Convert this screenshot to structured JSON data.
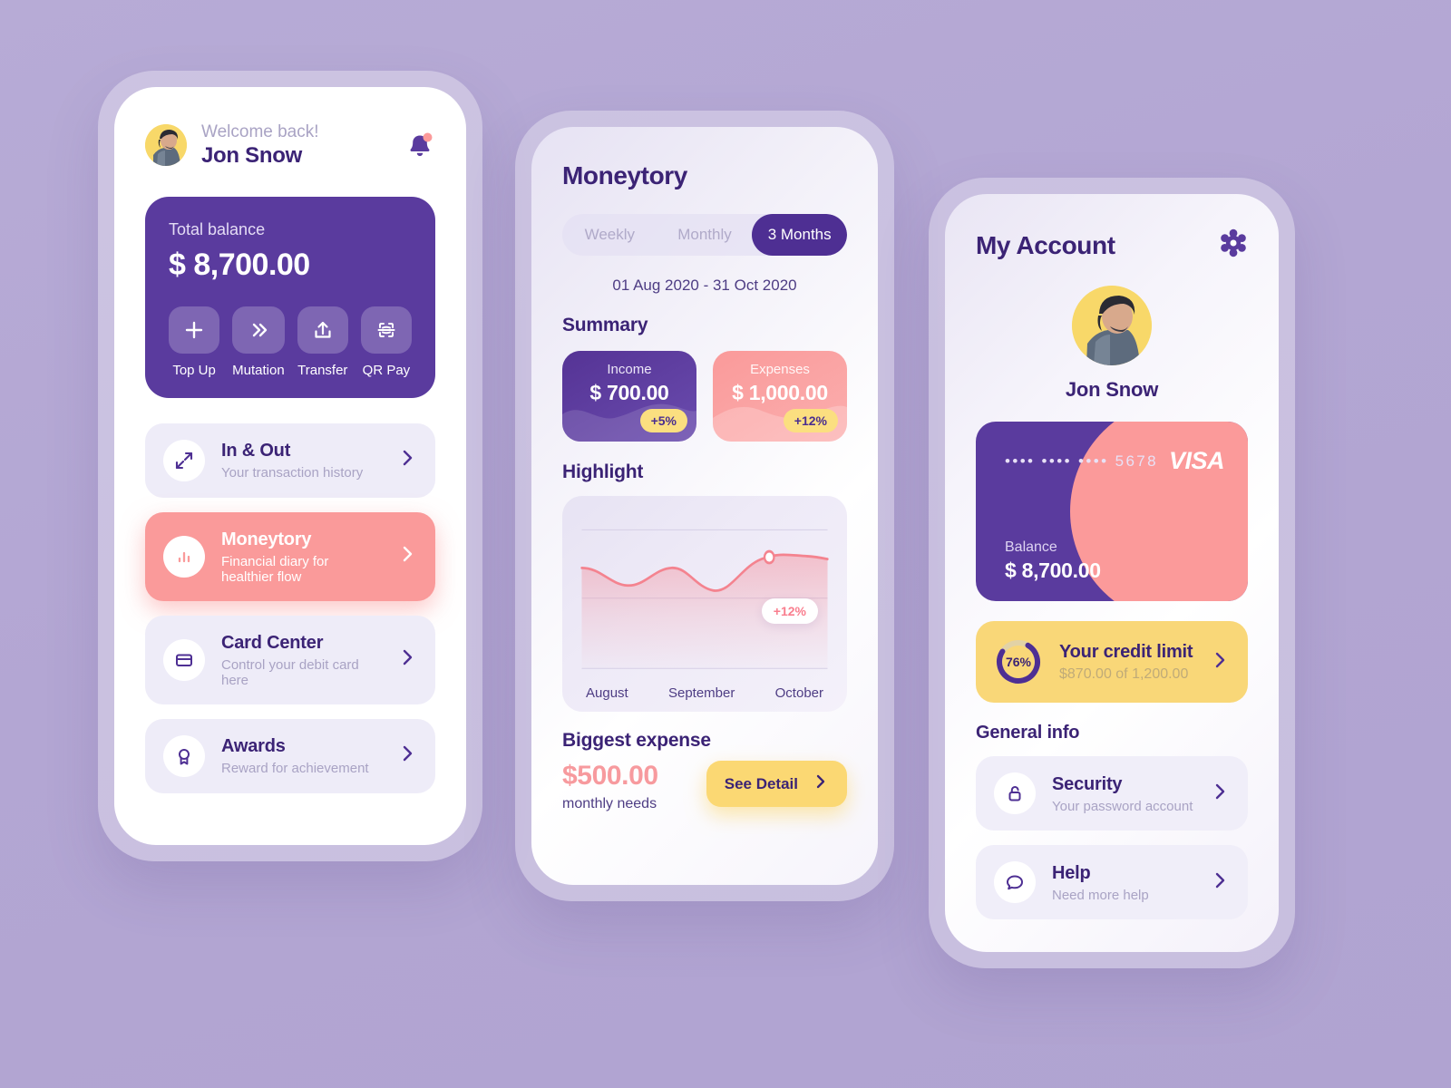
{
  "theme": {
    "background": "#b5a8d5",
    "primary_purple": "#5a3b9e",
    "deep_purple": "#3b2375",
    "accent_pink": "#fa9a9a",
    "accent_yellow": "#fbd873",
    "muted_text": "#a9a3c4"
  },
  "phone1": {
    "welcome_label": "Welcome back!",
    "user_name": "Jon Snow",
    "notification_icon": "bell-icon",
    "balance": {
      "label": "Total balance",
      "amount": "$ 8,700.00"
    },
    "actions": [
      {
        "label": "Top Up",
        "icon": "plus-icon"
      },
      {
        "label": "Mutation",
        "icon": "double-chevron-right-icon"
      },
      {
        "label": "Transfer",
        "icon": "upload-icon"
      },
      {
        "label": "QR Pay",
        "icon": "qr-scan-icon"
      }
    ],
    "menu": [
      {
        "title": "In & Out",
        "subtitle": "Your transaction history",
        "icon": "expand-arrows-icon",
        "active": false
      },
      {
        "title": "Moneytory",
        "subtitle": "Financial diary for healthier flow",
        "icon": "bar-chart-icon",
        "active": true
      },
      {
        "title": "Card Center",
        "subtitle": "Control your debit card here",
        "icon": "credit-card-icon",
        "active": false
      },
      {
        "title": "Awards",
        "subtitle": "Reward for achievement",
        "icon": "medal-icon",
        "active": false
      }
    ]
  },
  "phone2": {
    "title": "Moneytory",
    "tabs": [
      {
        "label": "Weekly",
        "selected": false
      },
      {
        "label": "Monthly",
        "selected": false
      },
      {
        "label": "3 Months",
        "selected": true
      }
    ],
    "date_range": "01 Aug 2020 - 31 Oct 2020",
    "summary_title": "Summary",
    "summary": [
      {
        "label": "Income",
        "amount": "$ 700.00",
        "badge": "+5%"
      },
      {
        "label": "Expenses",
        "amount": "$ 1,000.00",
        "badge": "+12%"
      }
    ],
    "highlight_title": "Highlight",
    "biggest_expense": {
      "title": "Biggest expense",
      "amount": "$500.00",
      "subtitle": "monthly needs",
      "button_label": "See Detail",
      "button_icon": "chevron-right-icon"
    }
  },
  "chart_data": {
    "type": "area",
    "title": "Highlight",
    "xlabel": "",
    "ylabel": "",
    "categories": [
      "August",
      "September",
      "October"
    ],
    "tick_labels": [
      "August",
      "September",
      "October"
    ],
    "x": [
      0,
      1,
      2,
      3,
      4,
      5,
      6,
      7,
      8,
      9,
      10
    ],
    "values": [
      62,
      57,
      50,
      49,
      53,
      62,
      63,
      54,
      44,
      47,
      62,
      71,
      70
    ],
    "annotation": {
      "label": "+12%",
      "at_category": "October",
      "value": 71
    },
    "marker_point": {
      "label": "+12%",
      "x": 9.3,
      "y": 71
    },
    "ylim": [
      0,
      100
    ],
    "grid": true,
    "gridlines": [
      80,
      45,
      5
    ],
    "line_color": "#f4838f",
    "fill_color": "#f4838f",
    "legend": "none"
  },
  "phone3": {
    "title": "My Account",
    "settings_icon": "gear-icon",
    "profile_name": "Jon Snow",
    "card": {
      "number_masked": "••••  ••••  ••••  5678",
      "brand": "VISA",
      "balance_label": "Balance",
      "balance_amount": "$ 8,700.00"
    },
    "credit": {
      "percent": "76%",
      "percent_value": 76,
      "title": "Your credit limit",
      "subtitle": "$870.00 of 1,200.00",
      "icon": "progress-ring-icon"
    },
    "general_info_title": "General info",
    "general_items": [
      {
        "title": "Security",
        "subtitle": "Your password account",
        "icon": "lock-icon"
      },
      {
        "title": "Help",
        "subtitle": "Need more help",
        "icon": "chat-bubble-icon"
      }
    ]
  }
}
